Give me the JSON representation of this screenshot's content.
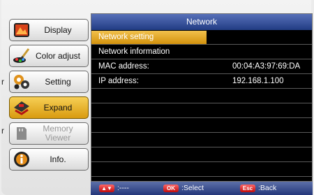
{
  "sidebar": {
    "items": [
      {
        "label": "Display",
        "icon": "display-icon"
      },
      {
        "label": "Color adjust",
        "icon": "color-brush-icon"
      },
      {
        "label": "Setting",
        "icon": "gears-icon"
      },
      {
        "label": "Expand",
        "icon": "expand-icon",
        "active": true
      },
      {
        "label": "Memory\nViewer",
        "icon": "memory-card-icon",
        "disabled": true
      },
      {
        "label": "Info.",
        "icon": "info-icon"
      }
    ]
  },
  "edge_chars": [
    "r",
    "r"
  ],
  "panel": {
    "title": "Network",
    "rows": [
      {
        "key": "Network setting",
        "value": "",
        "selected": true
      },
      {
        "key": "Network information",
        "value": ""
      },
      {
        "key": "MAC address:",
        "value": "00:04:A3:97:69:DA"
      },
      {
        "key": "IP address:",
        "value": "192.168.1.100"
      }
    ]
  },
  "bottom_bar": {
    "arrows_key": "▲▼",
    "arrows_text": ":----",
    "ok_key": "OK",
    "ok_text": ":Select",
    "esc_key": "Esc",
    "esc_text": ":Back"
  },
  "colors": {
    "accent_yellow": "#e3a922",
    "title_blue": "#2f4a94",
    "panel_bg": "#000000"
  }
}
